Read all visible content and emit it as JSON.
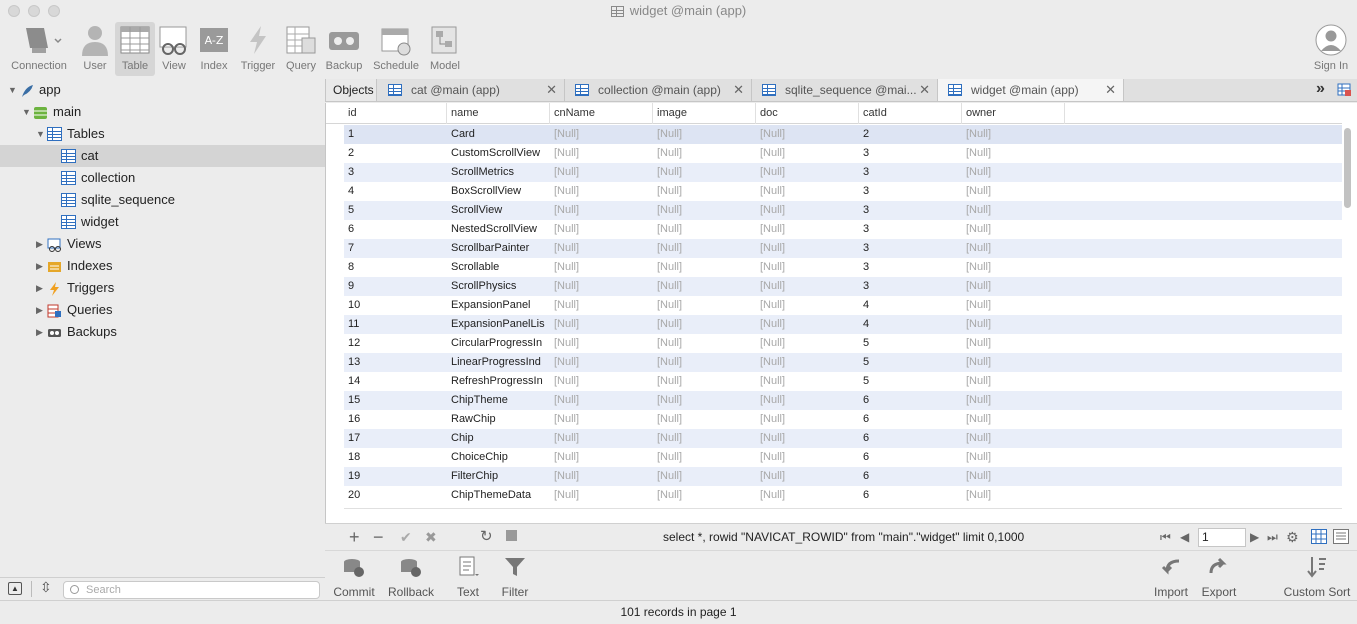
{
  "window": {
    "title": "widget @main (app)"
  },
  "toolbar": {
    "items": [
      {
        "label": "Connection",
        "icon": "connection-icon"
      },
      {
        "label": "User",
        "icon": "user-icon"
      },
      {
        "label": "Table",
        "icon": "table-icon"
      },
      {
        "label": "View",
        "icon": "view-icon"
      },
      {
        "label": "Index",
        "icon": "index-icon"
      },
      {
        "label": "Trigger",
        "icon": "trigger-icon"
      },
      {
        "label": "Query",
        "icon": "query-icon"
      },
      {
        "label": "Backup",
        "icon": "backup-icon"
      },
      {
        "label": "Schedule",
        "icon": "schedule-icon"
      },
      {
        "label": "Model",
        "icon": "model-icon"
      }
    ],
    "sign_in": "Sign In"
  },
  "sidebar": {
    "connection": "app",
    "database": "main",
    "tables_group": "Tables",
    "tables": [
      "cat",
      "collection",
      "sqlite_sequence",
      "widget"
    ],
    "groups": [
      "Views",
      "Indexes",
      "Triggers",
      "Queries",
      "Backups"
    ],
    "search_placeholder": "Search"
  },
  "tabs": {
    "objects": "Objects",
    "open": [
      {
        "label": "cat @main (app)"
      },
      {
        "label": "collection @main (app)"
      },
      {
        "label": "sqlite_sequence @mai..."
      },
      {
        "label": "widget @main (app)"
      }
    ],
    "overflow": "»"
  },
  "grid": {
    "columns": [
      "id",
      "name",
      "cnName",
      "image",
      "doc",
      "catId",
      "owner"
    ],
    "null_text": "[Null]",
    "rows": [
      {
        "id": "1",
        "name": "Card",
        "catId": "2"
      },
      {
        "id": "2",
        "name": "CustomScrollView",
        "catId": "3"
      },
      {
        "id": "3",
        "name": "ScrollMetrics",
        "catId": "3"
      },
      {
        "id": "4",
        "name": "BoxScrollView",
        "catId": "3"
      },
      {
        "id": "5",
        "name": "ScrollView",
        "catId": "3"
      },
      {
        "id": "6",
        "name": "NestedScrollView",
        "catId": "3"
      },
      {
        "id": "7",
        "name": "ScrollbarPainter",
        "catId": "3"
      },
      {
        "id": "8",
        "name": "Scrollable",
        "catId": "3"
      },
      {
        "id": "9",
        "name": "ScrollPhysics",
        "catId": "3"
      },
      {
        "id": "10",
        "name": "ExpansionPanel",
        "catId": "4"
      },
      {
        "id": "11",
        "name": "ExpansionPanelLis",
        "catId": "4"
      },
      {
        "id": "12",
        "name": "CircularProgressIn",
        "catId": "5"
      },
      {
        "id": "13",
        "name": "LinearProgressInd",
        "catId": "5"
      },
      {
        "id": "14",
        "name": "RefreshProgressIn",
        "catId": "5"
      },
      {
        "id": "15",
        "name": "ChipTheme",
        "catId": "6"
      },
      {
        "id": "16",
        "name": "RawChip",
        "catId": "6"
      },
      {
        "id": "17",
        "name": "Chip",
        "catId": "6"
      },
      {
        "id": "18",
        "name": "ChoiceChip",
        "catId": "6"
      },
      {
        "id": "19",
        "name": "FilterChip",
        "catId": "6"
      },
      {
        "id": "20",
        "name": "ChipThemeData",
        "catId": "6"
      }
    ]
  },
  "navbar": {
    "sql": "select *, rowid \"NAVICAT_ROWID\" from \"main\".\"widget\"  limit 0,1000",
    "page": "1"
  },
  "bottom_toolbar": {
    "commit": "Commit",
    "rollback": "Rollback",
    "text": "Text",
    "filter": "Filter",
    "import": "Import",
    "export": "Export",
    "custom_sort": "Custom Sort"
  },
  "status": {
    "records": "101 records in page 1"
  },
  "colors": {
    "accent": "#2f6fbf",
    "row_alt": "#e9eef9",
    "null_text": "#a8a8a8"
  }
}
